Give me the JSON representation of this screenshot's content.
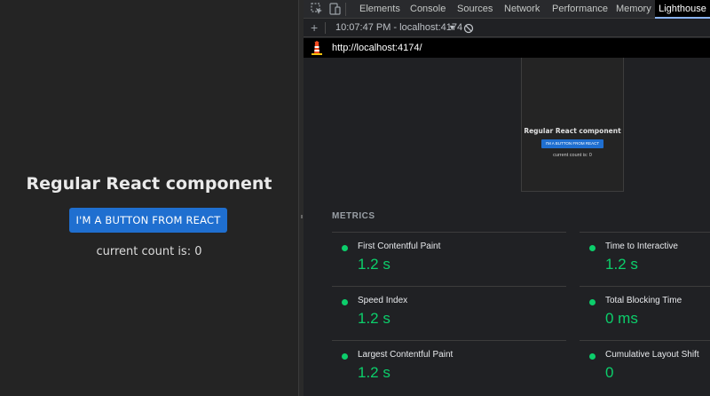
{
  "app": {
    "title": "Regular React component",
    "button_label": "I'M A BUTTON FROM REACT",
    "count_text": "current count is: 0"
  },
  "devtools": {
    "tabs": [
      {
        "label": "Elements",
        "active": false
      },
      {
        "label": "Console",
        "active": false
      },
      {
        "label": "Sources",
        "active": false
      },
      {
        "label": "Network",
        "active": false
      },
      {
        "label": "Performance",
        "active": false
      },
      {
        "label": "Memory",
        "active": false
      },
      {
        "label": "Lighthouse",
        "active": true
      }
    ],
    "report_select": "10:07:47 PM - localhost:4174",
    "url": "http://localhost:4174/"
  },
  "thumbnail": {
    "title": "Regular React component",
    "button_label": "I'M A BUTTON FROM REACT",
    "count_text": "current count is: 0"
  },
  "metrics": {
    "heading": "METRICS",
    "items": [
      {
        "label": "First Contentful Paint",
        "value": "1.2 s"
      },
      {
        "label": "Time to Interactive",
        "value": "1.2 s"
      },
      {
        "label": "Speed Index",
        "value": "1.2 s"
      },
      {
        "label": "Total Blocking Time",
        "value": "0 ms"
      },
      {
        "label": "Largest Contentful Paint",
        "value": "1.2 s"
      },
      {
        "label": "Cumulative Layout Shift",
        "value": "0"
      }
    ]
  },
  "colors": {
    "pass_green": "#0cce6b",
    "react_button_blue": "#1f6fd0",
    "devtools_bg": "#202124"
  }
}
